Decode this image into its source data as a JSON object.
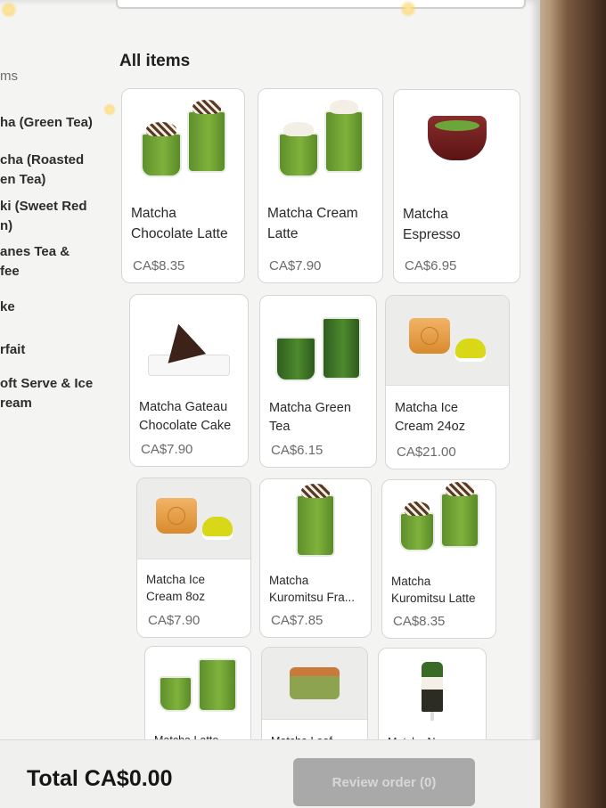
{
  "sidebar": {
    "categories": [
      {
        "label": "ms",
        "muted": true
      },
      {
        "label": "ha (Green Tea)"
      },
      {
        "label": "cha (Roasted\nen Tea)"
      },
      {
        "label": "ki (Sweet Red\nn)"
      },
      {
        "label": "anes Tea &\nfee"
      },
      {
        "label": "ke"
      },
      {
        "label": "rfait"
      },
      {
        "label": "oft Serve & Ice\nream"
      }
    ]
  },
  "main": {
    "heading": "All items",
    "products": [
      {
        "name": "Matcha\nChocolate Latte",
        "price": "CA$8.35",
        "icon": "matcha-chocolate-latte-icon"
      },
      {
        "name": "Matcha Cream\nLatte",
        "price": "CA$7.90",
        "icon": "matcha-cream-latte-icon"
      },
      {
        "name": "Matcha\nEspresso",
        "price": "CA$6.95",
        "icon": "matcha-espresso-bowl-icon"
      },
      {
        "name": "Matcha Gateau\nChocolate Cake",
        "price": "CA$7.90",
        "icon": "chocolate-cake-icon"
      },
      {
        "name": "Matcha Green\nTea",
        "price": "CA$6.15",
        "icon": "matcha-green-tea-icon"
      },
      {
        "name": "Matcha Ice\nCream 24oz",
        "price": "CA$21.00",
        "icon": "ice-cream-tub-icon"
      },
      {
        "name": "Matcha Ice\nCream 8oz",
        "price": "CA$7.90",
        "icon": "ice-cream-tub-icon"
      },
      {
        "name": "Matcha\nKuromitsu Fra...",
        "price": "CA$7.85",
        "icon": "kuromitsu-frappe-icon"
      },
      {
        "name": "Matcha\nKuromitsu Latte",
        "price": "CA$8.35",
        "icon": "kuromitsu-latte-icon"
      },
      {
        "name": "Matcha Latte",
        "price": "",
        "icon": "matcha-latte-icon"
      },
      {
        "name": "Matcha Loaf",
        "price": "",
        "icon": "matcha-loaf-icon"
      },
      {
        "name": "Matcha Nama",
        "price": "",
        "icon": "matcha-parfait-icon"
      }
    ]
  },
  "footer": {
    "total": "Total CA$0.00",
    "review_button": "Review order (0)"
  },
  "colors": {
    "matcha_green": "#6ea43a",
    "button_disabled": "#a9a9a9",
    "background": "#f4f4f2"
  }
}
